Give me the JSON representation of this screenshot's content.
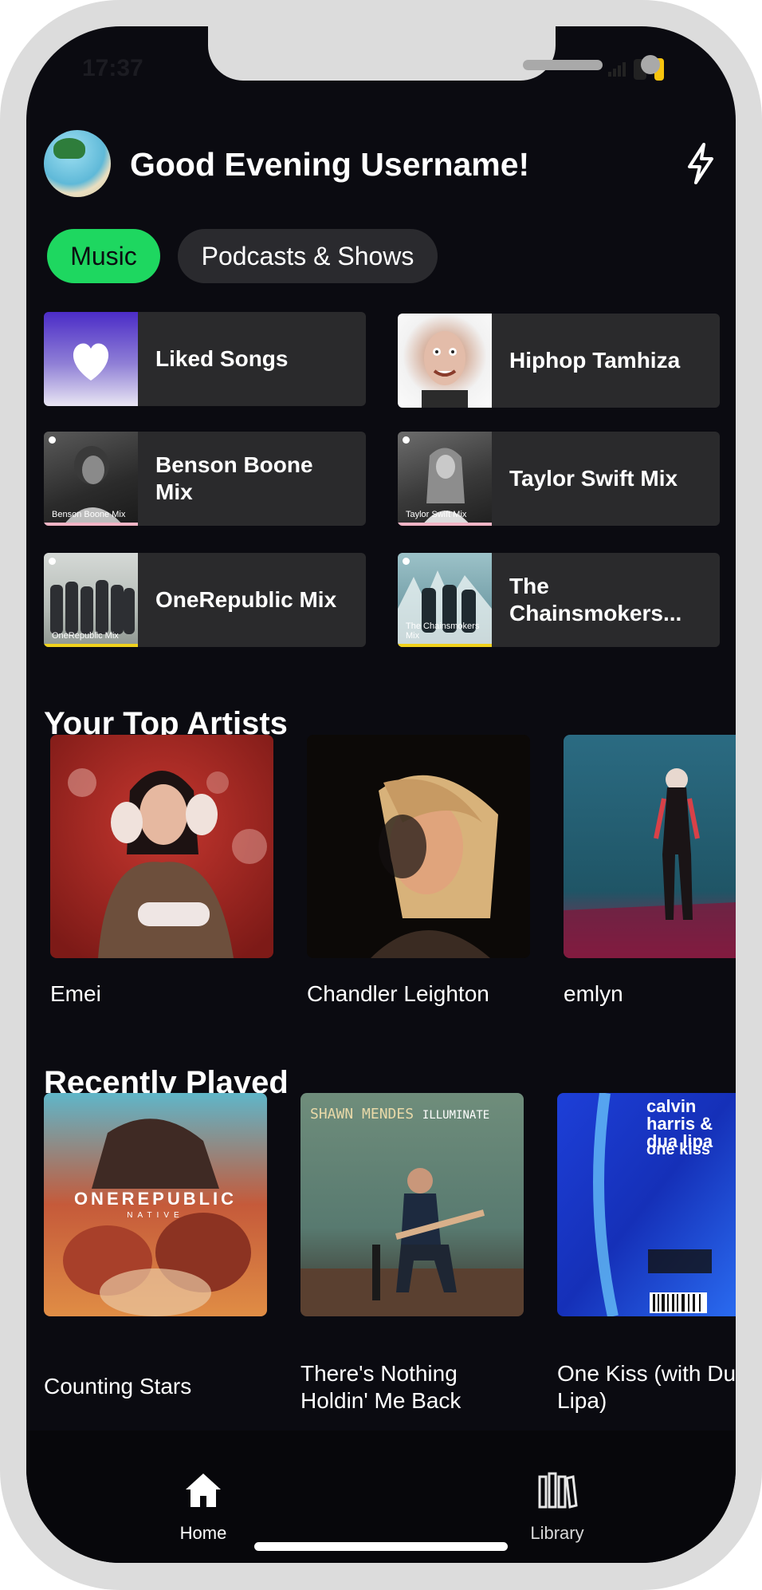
{
  "status": {
    "time": "17:37"
  },
  "header": {
    "greeting": "Good Evening Username!"
  },
  "filters": [
    {
      "label": "Music",
      "active": true
    },
    {
      "label": "Podcasts & Shows",
      "active": false
    }
  ],
  "shortcuts": [
    {
      "title": "Liked Songs",
      "art_label": ""
    },
    {
      "title": "Hiphop Tamhiza",
      "art_label": ""
    },
    {
      "title": "Benson Boone Mix",
      "art_label": "Benson Boone Mix"
    },
    {
      "title": "Taylor Swift Mix",
      "art_label": "Taylor Swift Mix"
    },
    {
      "title": "OneRepublic Mix",
      "art_label": "OneRepublic Mix"
    },
    {
      "title": "The Chainsmokers...",
      "art_label": "The Chainsmokers Mix"
    }
  ],
  "top_artists": {
    "title": "Your Top Artists",
    "items": [
      {
        "name": "Emei"
      },
      {
        "name": "Chandler Leighton"
      },
      {
        "name": "emlyn"
      }
    ]
  },
  "recently_played": {
    "title": "Recently Played",
    "items": [
      {
        "title": "Counting Stars",
        "cover_text": "ONEREPUBLIC",
        "cover_sub": "NATIVE"
      },
      {
        "title": "There's Nothing Holdin' Me Back",
        "cover_text": "SHAWN MENDES",
        "cover_sub": "ILLUMINATE"
      },
      {
        "title": "One Kiss (with Dua Lipa)",
        "cover_text": "calvin harris & dua lipa",
        "cover_sub": "one kiss"
      }
    ]
  },
  "tabbar": {
    "home_label": "Home",
    "library_label": "Library"
  },
  "colors": {
    "accent": "#1ed760",
    "background": "#0b0b11",
    "tile": "#2a2a2c"
  }
}
